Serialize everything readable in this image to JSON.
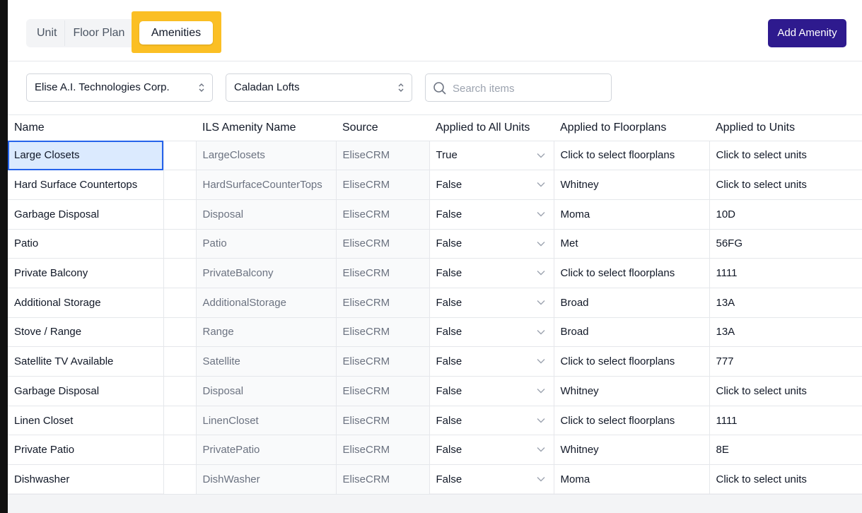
{
  "tabs": {
    "unit": "Unit",
    "floor_plan": "Floor Plan",
    "amenities": "Amenities"
  },
  "header": {
    "add_button": "Add Amenity"
  },
  "filters": {
    "company": "Elise A.I. Technologies Corp.",
    "property": "Caladan Lofts",
    "search_placeholder": "Search items"
  },
  "table": {
    "columns": [
      "Name",
      "",
      "ILS Amenity Name",
      "Source",
      "Applied to All Units",
      "Applied to Floorplans",
      "Applied to Units"
    ],
    "rows": [
      {
        "name": "Large Closets",
        "ils": "LargeClosets",
        "source": "EliseCRM",
        "all": "True",
        "floorplans": "Click to select floorplans",
        "units": "Click to select units"
      },
      {
        "name": "Hard Surface Countertops",
        "ils": "HardSurfaceCounterTops",
        "source": "EliseCRM",
        "all": "False",
        "floorplans": "Whitney",
        "units": "Click to select units"
      },
      {
        "name": "Garbage Disposal",
        "ils": "Disposal",
        "source": "EliseCRM",
        "all": "False",
        "floorplans": "Moma",
        "units": "10D"
      },
      {
        "name": "Patio",
        "ils": "Patio",
        "source": "EliseCRM",
        "all": "False",
        "floorplans": "Met",
        "units": "56FG"
      },
      {
        "name": "Private Balcony",
        "ils": "PrivateBalcony",
        "source": "EliseCRM",
        "all": "False",
        "floorplans": "Click to select floorplans",
        "units": "1111"
      },
      {
        "name": "Additional Storage",
        "ils": "AdditionalStorage",
        "source": "EliseCRM",
        "all": "False",
        "floorplans": "Broad",
        "units": "13A"
      },
      {
        "name": "Stove / Range",
        "ils": "Range",
        "source": "EliseCRM",
        "all": "False",
        "floorplans": "Broad",
        "units": "13A"
      },
      {
        "name": "Satellite TV Available",
        "ils": "Satellite",
        "source": "EliseCRM",
        "all": "False",
        "floorplans": "Click to select floorplans",
        "units": "777"
      },
      {
        "name": "Garbage Disposal",
        "ils": "Disposal",
        "source": "EliseCRM",
        "all": "False",
        "floorplans": "Whitney",
        "units": "Click to select units"
      },
      {
        "name": "Linen Closet",
        "ils": "LinenCloset",
        "source": "EliseCRM",
        "all": "False",
        "floorplans": "Click to select floorplans",
        "units": "1111"
      },
      {
        "name": "Private Patio",
        "ils": "PrivatePatio",
        "source": "EliseCRM",
        "all": "False",
        "floorplans": "Whitney",
        "units": "8E"
      },
      {
        "name": "Dishwasher",
        "ils": "DishWasher",
        "source": "EliseCRM",
        "all": "False",
        "floorplans": "Moma",
        "units": "Click to select units"
      }
    ]
  },
  "colors": {
    "accent": "#2e1a8e",
    "highlight": "#fbbf24",
    "selected_cell": "#dbeafe"
  }
}
